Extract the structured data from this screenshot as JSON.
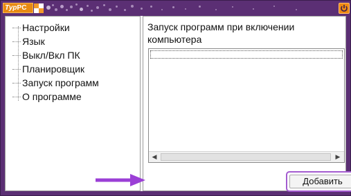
{
  "app": {
    "logo_prefix": "Тур",
    "logo_suffix": "PC"
  },
  "sidebar": {
    "items": [
      {
        "label": "Настройки"
      },
      {
        "label": "Язык"
      },
      {
        "label": "Выкл/Вкл ПК"
      },
      {
        "label": "Планировщик"
      },
      {
        "label": "Запуск программ"
      },
      {
        "label": "О программе"
      }
    ]
  },
  "main": {
    "heading": "Запуск программ при включении компьютера",
    "add_button_label": "Добавить"
  },
  "colors": {
    "titlebar": "#5b2f74",
    "logo": "#e88a12",
    "highlight": "#a35bd0",
    "arrow": "#9b3fd6"
  },
  "icons": {
    "power": "power-icon",
    "arrow": "arrow-right-icon"
  }
}
